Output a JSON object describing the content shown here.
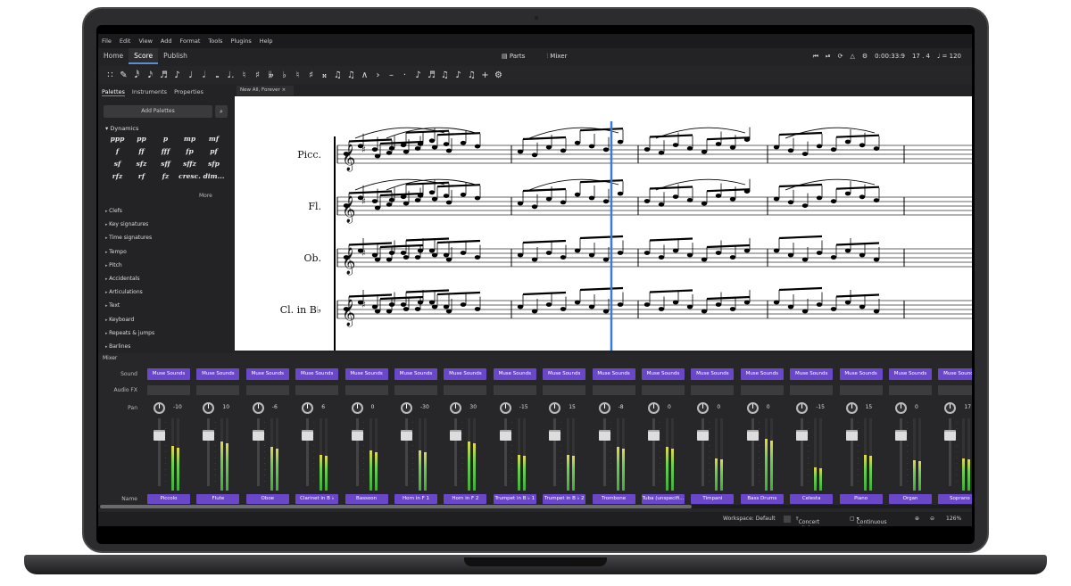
{
  "menu": [
    "File",
    "Edit",
    "View",
    "Add",
    "Format",
    "Tools",
    "Plugins",
    "Help"
  ],
  "tabs": {
    "home": "Home",
    "score": "Score",
    "publish": "Publish"
  },
  "center_tools": {
    "parts": "Parts",
    "mixer": "Mixer"
  },
  "playback": {
    "time": "0:00:33:9",
    "position": "17 . 4",
    "tempo": "♩ = 120"
  },
  "toolbar_glyphs": [
    "∷",
    "✎",
    "𝅘𝅥𝅰",
    "𝅘𝅥𝅯",
    "♬",
    "♪",
    "♩",
    "𝅗𝅥",
    "𝅝",
    "♩.",
    "♮",
    "♯",
    "𝄫",
    "♭",
    "♮",
    "♯",
    "𝄪",
    "♫",
    "♫",
    "∧",
    "›",
    "–",
    "·",
    "♪",
    "♬",
    "♫",
    "♪",
    "♫",
    "+",
    "⚙"
  ],
  "palette_tabs": {
    "palettes": "Palettes",
    "instruments": "Instruments",
    "properties": "Properties"
  },
  "add_palettes": "Add Palettes",
  "dynamics_header": "Dynamics",
  "dynamics": [
    "ppp",
    "pp",
    "p",
    "mp",
    "mf",
    "f",
    "ff",
    "fff",
    "fp",
    "pf",
    "sf",
    "sfz",
    "sff",
    "sffz",
    "sfp",
    "rfz",
    "rf",
    "fz",
    "cresc.",
    "dim..."
  ],
  "more": "More",
  "palettes": [
    "Clefs",
    "Key signatures",
    "Time signatures",
    "Tempo",
    "Pitch",
    "Accidentals",
    "Articulations",
    "Text",
    "Keyboard",
    "Repeats & jumps",
    "Barlines"
  ],
  "doc_tab": "New All, Forever",
  "instruments": [
    "Picc.",
    "Fl.",
    "Ob.",
    "Cl. in B♭"
  ],
  "mixer": {
    "title": "Mixer",
    "labels": {
      "sound": "Sound",
      "audio_fx": "Audio FX",
      "pan": "Pan",
      "name": "Name"
    },
    "sound_label": "Muse Sounds",
    "channels": [
      {
        "name": "Piccolo",
        "pan": "-10",
        "level": 0.62
      },
      {
        "name": "Flute",
        "pan": "10",
        "level": 0.68
      },
      {
        "name": "Oboe",
        "pan": "-6",
        "level": 0.6
      },
      {
        "name": "Clarinet in B ♭",
        "pan": "6",
        "level": 0.5
      },
      {
        "name": "Bassoon",
        "pan": "0",
        "level": 0.55
      },
      {
        "name": "Horn in F 1",
        "pan": "-30",
        "level": 0.55
      },
      {
        "name": "Horn in F 2",
        "pan": "30",
        "level": 0.68
      },
      {
        "name": "Trumpet in B ♭ 1",
        "pan": "-15",
        "level": 0.5
      },
      {
        "name": "Trumpet in B ♭ 2",
        "pan": "15",
        "level": 0.5
      },
      {
        "name": "Trombone",
        "pan": "-8",
        "level": 0.6
      },
      {
        "name": "Tuba (unspecifi...",
        "pan": "0",
        "level": 0.6
      },
      {
        "name": "Timpani",
        "pan": "0",
        "level": 0.45
      },
      {
        "name": "Bass Drums",
        "pan": "0",
        "level": 0.72
      },
      {
        "name": "Celesta",
        "pan": "-15",
        "level": 0.32
      },
      {
        "name": "Piano",
        "pan": "15",
        "level": 0.5
      },
      {
        "name": "Organ",
        "pan": "0",
        "level": 0.42
      },
      {
        "name": "Soprano",
        "pan": "17",
        "level": 0.45
      }
    ]
  },
  "status": {
    "workspace": "Workspace: Default",
    "concert_pitch": "Concert pitch",
    "view_mode": "Continuous view",
    "zoom": "126%"
  },
  "colors": {
    "accent": "#6a46c9",
    "playhead": "#3a7bd5"
  }
}
